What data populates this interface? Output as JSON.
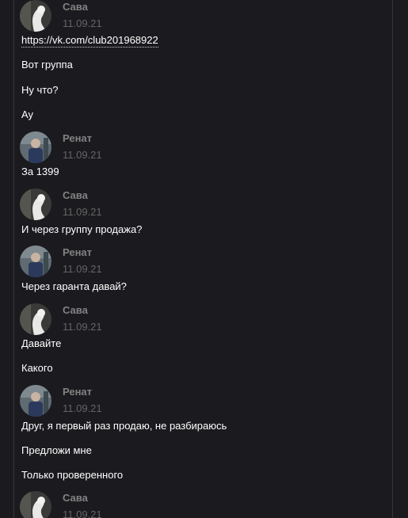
{
  "messages": [
    {
      "author": "Сава",
      "date": "11.09.21",
      "lines": [
        {
          "text": "https://vk.com/club201968922",
          "link": true
        },
        {
          "text": "Вот группа"
        },
        {
          "text": "Ну что?"
        },
        {
          "text": "Ау"
        }
      ]
    },
    {
      "author": "Ренат",
      "date": "11.09.21",
      "lines": [
        {
          "text": "За 1399"
        }
      ]
    },
    {
      "author": "Сава",
      "date": "11.09.21",
      "lines": [
        {
          "text": "И через группу продажа?"
        }
      ]
    },
    {
      "author": "Ренат",
      "date": "11.09.21",
      "lines": [
        {
          "text": "Через гаранта давай?"
        }
      ]
    },
    {
      "author": "Сава",
      "date": "11.09.21",
      "lines": [
        {
          "text": "Давайте"
        },
        {
          "text": "Какого"
        }
      ]
    },
    {
      "author": "Ренат",
      "date": "11.09.21",
      "lines": [
        {
          "text": "Друг, я первый раз продаю, не разбираюсь"
        },
        {
          "text": "Предложи мне"
        },
        {
          "text": "Только проверенного"
        }
      ]
    },
    {
      "author": "Сава",
      "date": "11.09.21",
      "lines": []
    }
  ]
}
